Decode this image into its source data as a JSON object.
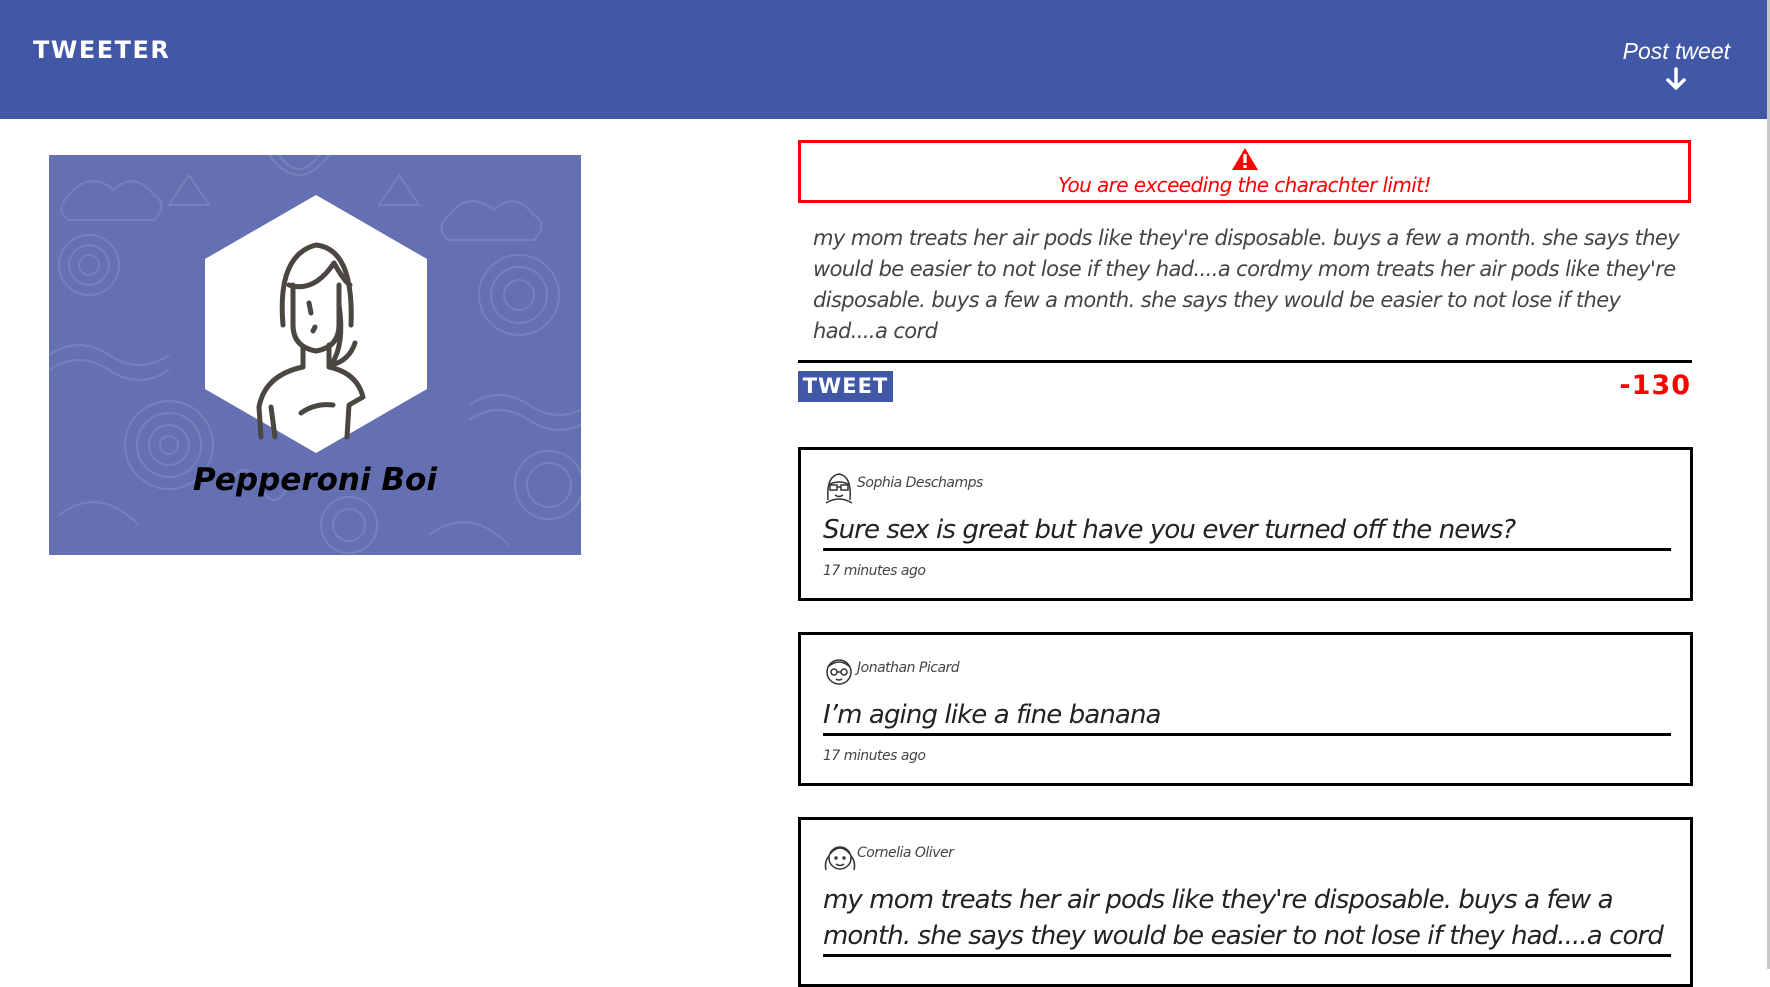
{
  "nav": {
    "brand": "TWEETER",
    "post_label": "Post tweet",
    "post_icon": "arrow-down-icon",
    "background": "#4058a5"
  },
  "profile": {
    "name": "Pepperoni Boi",
    "avatar_icon": "woman-avatar-icon",
    "background": "#6470b1"
  },
  "composer": {
    "warning_icon": "warning-triangle-icon",
    "warning_message": "You are exceeding the charachter limit!",
    "text": "my mom treats her air pods like they're disposable. buys a few a month. she says they would be easier to not lose if they had....a cordmy mom treats her air pods like they're disposable. buys a few a month. she says they would be easier to not lose if they had....a cord",
    "tweet_button": "TWEET",
    "char_count": "-130",
    "warning_color": "#ff0000"
  },
  "tweets": [
    {
      "author": "Sophia Deschamps",
      "avatar_icon": "woman-glasses-avatar-icon",
      "text": "Sure sex is great but have you ever turned off the news?",
      "time": "17 minutes ago"
    },
    {
      "author": "Jonathan Picard",
      "avatar_icon": "man-glasses-avatar-icon",
      "text": "I’m aging like a fine banana",
      "time": "17 minutes ago"
    },
    {
      "author": "Cornelia Oliver",
      "avatar_icon": "girl-pigtails-avatar-icon",
      "text": "my mom treats her air pods like they're disposable. buys a few a month. she says they would be easier to not lose if they had....a cord",
      "time": ""
    }
  ]
}
